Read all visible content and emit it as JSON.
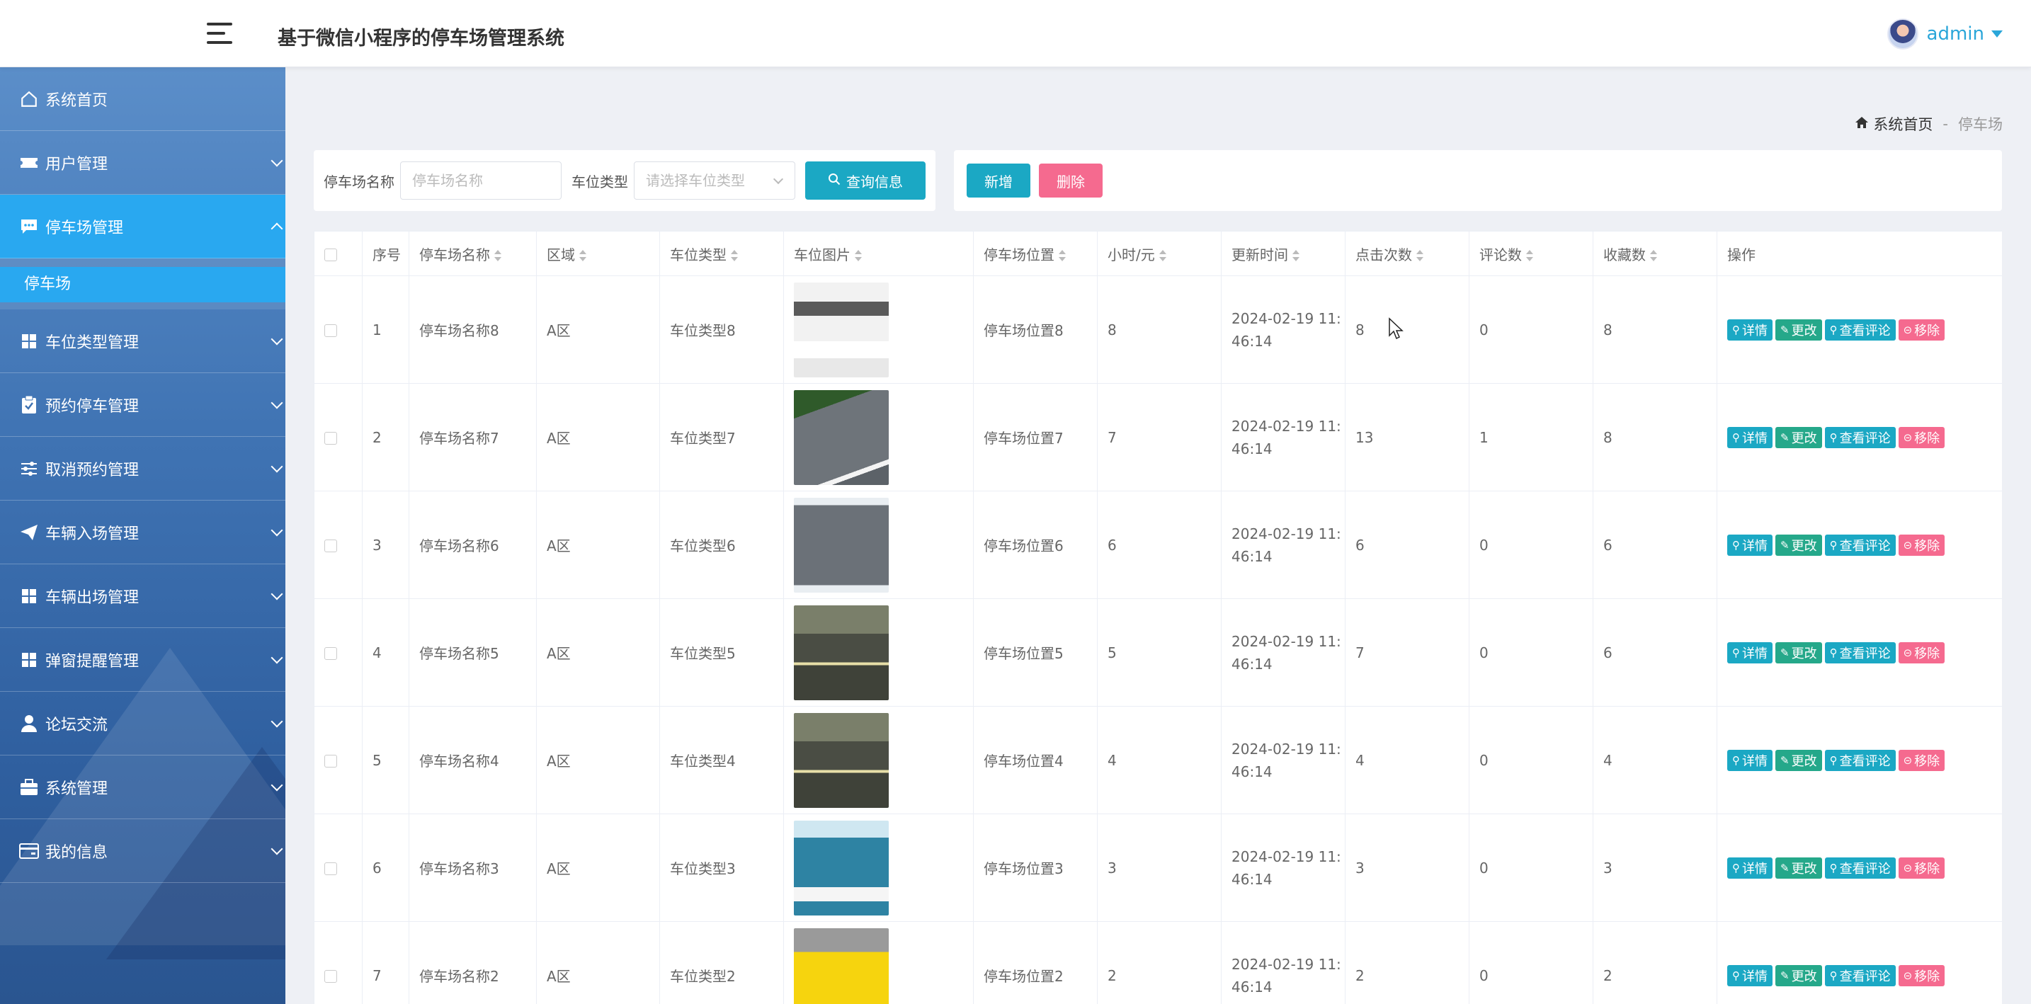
{
  "app": {
    "title": "基于微信小程序的停车场管理系统",
    "user": "admin"
  },
  "sidebar": {
    "items": [
      {
        "label": "系统首页",
        "icon": "home-icon"
      },
      {
        "label": "用户管理",
        "icon": "ticket-icon"
      },
      {
        "label": "停车场管理",
        "icon": "chat-icon",
        "active": true
      },
      {
        "label": "车位类型管理",
        "icon": "grid-icon"
      },
      {
        "label": "预约停车管理",
        "icon": "clipboard-check-icon"
      },
      {
        "label": "取消预约管理",
        "icon": "sliders-icon"
      },
      {
        "label": "车辆入场管理",
        "icon": "paper-plane-icon"
      },
      {
        "label": "车辆出场管理",
        "icon": "grid-icon"
      },
      {
        "label": "弹窗提醒管理",
        "icon": "grid-icon"
      },
      {
        "label": "论坛交流",
        "icon": "user-icon"
      },
      {
        "label": "系统管理",
        "icon": "briefcase-icon"
      },
      {
        "label": "我的信息",
        "icon": "card-icon"
      }
    ],
    "sub_item": "停车场"
  },
  "breadcrumb": {
    "home": "系统首页",
    "separator": "-",
    "current": "停车场"
  },
  "search": {
    "name_label": "停车场名称",
    "name_placeholder": "停车场名称",
    "type_label": "车位类型",
    "type_placeholder": "请选择车位类型",
    "button": "查询信息"
  },
  "actions": {
    "add": "新增",
    "delete": "删除"
  },
  "table": {
    "headers": [
      "序号",
      "停车场名称",
      "区域",
      "车位类型",
      "车位图片",
      "停车场位置",
      "小时/元",
      "更新时间",
      "点击次数",
      "评论数",
      "收藏数",
      "操作"
    ],
    "op_labels": {
      "detail": "详情",
      "edit": "更改",
      "comment": "查看评论",
      "remove": "移除"
    },
    "rows": [
      {
        "no": "1",
        "name": "停车场名称8",
        "area": "A区",
        "type": "车位类型8",
        "location": "停车场位置8",
        "price": "8",
        "time1": "2024-02-19 11:",
        "time2": "46:14",
        "clicks": "8",
        "comments": "0",
        "favs": "8"
      },
      {
        "no": "2",
        "name": "停车场名称7",
        "area": "A区",
        "type": "车位类型7",
        "location": "停车场位置7",
        "price": "7",
        "time1": "2024-02-19 11:",
        "time2": "46:14",
        "clicks": "13",
        "comments": "1",
        "favs": "8"
      },
      {
        "no": "3",
        "name": "停车场名称6",
        "area": "A区",
        "type": "车位类型6",
        "location": "停车场位置6",
        "price": "6",
        "time1": "2024-02-19 11:",
        "time2": "46:14",
        "clicks": "6",
        "comments": "0",
        "favs": "6"
      },
      {
        "no": "4",
        "name": "停车场名称5",
        "area": "A区",
        "type": "车位类型5",
        "location": "停车场位置5",
        "price": "5",
        "time1": "2024-02-19 11:",
        "time2": "46:14",
        "clicks": "7",
        "comments": "0",
        "favs": "6"
      },
      {
        "no": "5",
        "name": "停车场名称4",
        "area": "A区",
        "type": "车位类型4",
        "location": "停车场位置4",
        "price": "4",
        "time1": "2024-02-19 11:",
        "time2": "46:14",
        "clicks": "4",
        "comments": "0",
        "favs": "4"
      },
      {
        "no": "6",
        "name": "停车场名称3",
        "area": "A区",
        "type": "车位类型3",
        "location": "停车场位置3",
        "price": "3",
        "time1": "2024-02-19 11:",
        "time2": "46:14",
        "clicks": "3",
        "comments": "0",
        "favs": "3"
      },
      {
        "no": "7",
        "name": "停车场名称2",
        "area": "A区",
        "type": "车位类型2",
        "location": "停车场位置2",
        "price": "2",
        "time1": "2024-02-19 11:",
        "time2": "46:14",
        "clicks": "2",
        "comments": "0",
        "favs": "2"
      }
    ]
  }
}
